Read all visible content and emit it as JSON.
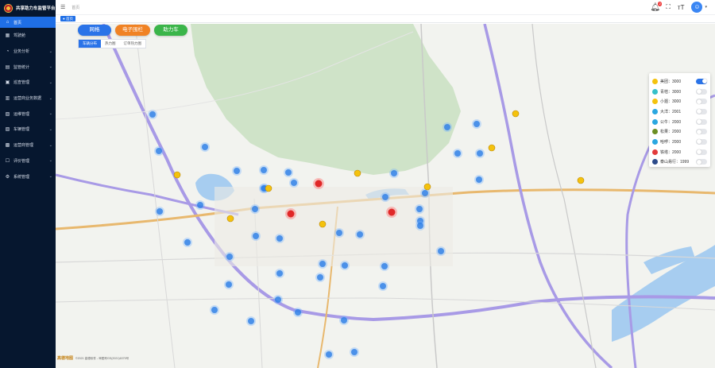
{
  "app": {
    "title": "共享助力车监管平台"
  },
  "sidebar": {
    "items": [
      {
        "label": "首页",
        "icon": "home-icon",
        "glyph": "⌂",
        "active": true,
        "has_arrow": false
      },
      {
        "label": "驾驶舱",
        "icon": "dashboard-icon",
        "glyph": "▦",
        "active": false,
        "has_arrow": false
      },
      {
        "label": "业务分析",
        "icon": "chart-icon",
        "glyph": "◔",
        "active": false,
        "has_arrow": true
      },
      {
        "label": "监管统计",
        "icon": "stats-icon",
        "glyph": "▤",
        "active": false,
        "has_arrow": true
      },
      {
        "label": "巡查管理",
        "icon": "patrol-icon",
        "glyph": "▣",
        "active": false,
        "has_arrow": true
      },
      {
        "label": "运营商业务数据",
        "icon": "data-icon",
        "glyph": "▥",
        "active": false,
        "has_arrow": true
      },
      {
        "label": "运维管理",
        "icon": "maintenance-icon",
        "glyph": "▧",
        "active": false,
        "has_arrow": true
      },
      {
        "label": "车辆管理",
        "icon": "vehicle-icon",
        "glyph": "▨",
        "active": false,
        "has_arrow": true
      },
      {
        "label": "运营商管理",
        "icon": "operator-icon",
        "glyph": "▩",
        "active": false,
        "has_arrow": true
      },
      {
        "label": "评价管理",
        "icon": "evaluation-icon",
        "glyph": "☐",
        "active": false,
        "has_arrow": true
      },
      {
        "label": "系统管理",
        "icon": "settings-icon",
        "glyph": "⚙",
        "active": false,
        "has_arrow": true
      }
    ]
  },
  "header": {
    "breadcrumb": "首页",
    "notification_count": "2",
    "avatar_glyph": "☺"
  },
  "tags": {
    "home": "● 首页"
  },
  "map_controls": {
    "buttons": [
      {
        "label": "网格",
        "color": "#2a73e8"
      },
      {
        "label": "电子围栏",
        "color": "#f08224"
      },
      {
        "label": "助力车",
        "color": "#3bb54a"
      }
    ],
    "subtabs": [
      {
        "label": "车辆分布",
        "active": true
      },
      {
        "label": "热力图",
        "active": false
      },
      {
        "label": "订单热力图",
        "active": false
      }
    ]
  },
  "legend": {
    "items": [
      {
        "label": "美团：3000",
        "color": "#f4c20d",
        "on": true
      },
      {
        "label": "青桔：3000",
        "color": "#35c0c9",
        "on": false
      },
      {
        "label": "小遛：3000",
        "color": "#f4c20d",
        "on": false
      },
      {
        "label": "大洋：2001",
        "color": "#2aa7e0",
        "on": false
      },
      {
        "label": "公牛：2000",
        "color": "#2aa7e0",
        "on": false
      },
      {
        "label": "松果：2000",
        "color": "#6b8e23",
        "on": false
      },
      {
        "label": "哈啰：2000",
        "color": "#2aa7e0",
        "on": false
      },
      {
        "label": "铁塔：2000",
        "color": "#e23b3b",
        "on": false
      },
      {
        "label": "泰山易行：1999",
        "color": "#2d4b8a",
        "on": false
      }
    ]
  },
  "map": {
    "copyright": "©2021 高德软件 - 审图号GS(2021)6375号",
    "logo": "高德地图"
  }
}
